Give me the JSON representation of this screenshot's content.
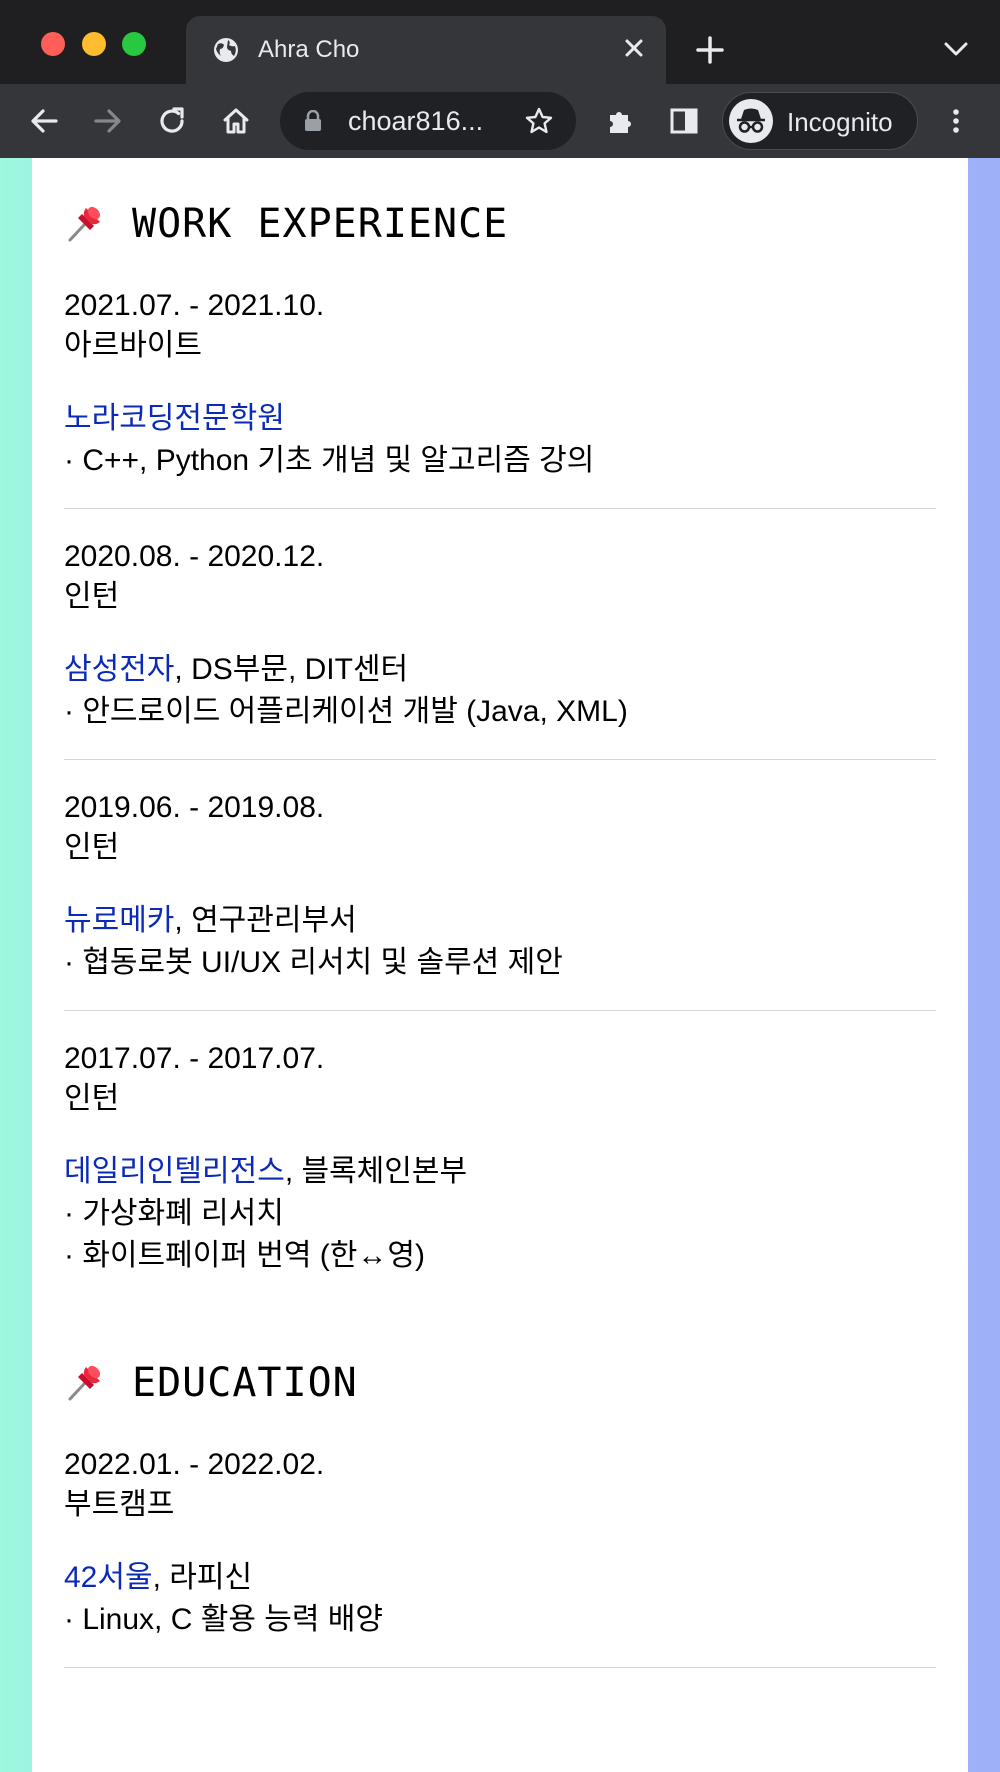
{
  "browser": {
    "tab_title": "Ahra Cho",
    "url": "choar816...",
    "incognito_label": "Incognito"
  },
  "work": {
    "title": "WORK EXPERIENCE",
    "entries": [
      {
        "period": "2021.07. - 2021.10.",
        "role": "아르바이트",
        "org_link": "노라코딩전문학원",
        "org_rest": "",
        "bullets": [
          "· C++, Python 기초 개념 및 알고리즘 강의"
        ]
      },
      {
        "period": "2020.08. - 2020.12.",
        "role": "인턴",
        "org_link": "삼성전자",
        "org_rest": ", DS부문, DIT센터",
        "bullets": [
          "· 안드로이드 어플리케이션 개발 (Java, XML)"
        ]
      },
      {
        "period": "2019.06. - 2019.08.",
        "role": "인턴",
        "org_link": "뉴로메카",
        "org_rest": ", 연구관리부서",
        "bullets": [
          "· 협동로봇 UI/UX 리서치 및 솔루션 제안"
        ]
      },
      {
        "period": "2017.07. - 2017.07.",
        "role": "인턴",
        "org_link": "데일리인텔리전스",
        "org_rest": ", 블록체인본부",
        "bullets": [
          "· 가상화폐 리서치",
          "· 화이트페이퍼 번역 (한↔영)"
        ]
      }
    ]
  },
  "education": {
    "title": "EDUCATION",
    "entries": [
      {
        "period": "2022.01. - 2022.02.",
        "role": "부트캠프",
        "org_link": "42서울",
        "org_rest": ", 라피신",
        "bullets": [
          "· Linux, C 활용 능력 배양"
        ]
      }
    ]
  },
  "colors": {
    "link": "#0b2ab8",
    "tab_bg": "#35363a",
    "frame_bg": "#1f1f22"
  },
  "icons": [
    "globe-icon",
    "close-icon",
    "plus-icon",
    "chevron-down-icon",
    "back-icon",
    "forward-icon",
    "reload-icon",
    "home-icon",
    "lock-icon",
    "star-icon",
    "puzzle-icon",
    "sidepanel-icon",
    "incognito-icon",
    "kebab-menu-icon",
    "pushpin-icon"
  ]
}
